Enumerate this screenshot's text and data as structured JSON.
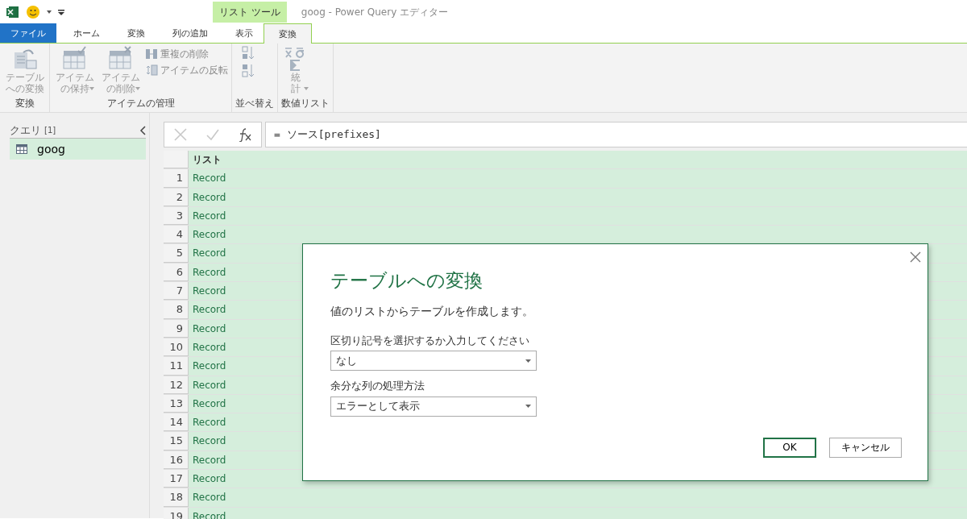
{
  "window": {
    "title": "goog - Power Query エディター",
    "context_label": "リスト ツール"
  },
  "tabs": [
    {
      "label": "ファイル",
      "kind": "file",
      "selected": false
    },
    {
      "label": "ホーム",
      "kind": "normal",
      "selected": false
    },
    {
      "label": "変換",
      "kind": "normal",
      "selected": false
    },
    {
      "label": "列の追加",
      "kind": "normal",
      "selected": false
    },
    {
      "label": "表示",
      "kind": "normal",
      "selected": false
    },
    {
      "label": "変換",
      "kind": "normal",
      "selected": true
    }
  ],
  "ribbon_groups": [
    {
      "label": "変換",
      "items": [
        {
          "kind": "large",
          "label": "テーブルへの変換",
          "caret": false,
          "disabled": true
        }
      ]
    },
    {
      "label": "アイテムの管理",
      "items": [
        {
          "kind": "large",
          "label": "アイテムの保持",
          "caret": true,
          "disabled": true
        },
        {
          "kind": "large",
          "label": "アイテムの削除",
          "caret": true,
          "disabled": true
        },
        {
          "kind": "small",
          "icons": [
            {
              "label": "重複の削除",
              "disabled": true
            },
            {
              "label": "アイテムの反転",
              "disabled": true
            }
          ]
        }
      ]
    },
    {
      "label": "並べ替え",
      "items": [
        {
          "kind": "sort",
          "disabled": true
        }
      ]
    },
    {
      "label": "数値リスト",
      "items": [
        {
          "kind": "large",
          "label": "統計",
          "caret": true,
          "disabled": true
        }
      ]
    }
  ],
  "queries": {
    "title": "クエリ",
    "count": "[1]",
    "items": [
      {
        "label": "goog",
        "selected": true
      }
    ]
  },
  "formula_bar": {
    "formula": "= ソース[prefixes]"
  },
  "table": {
    "column": "リスト",
    "rows": [
      {
        "n": "1",
        "v": "Record"
      },
      {
        "n": "2",
        "v": "Record"
      },
      {
        "n": "3",
        "v": "Record"
      },
      {
        "n": "4",
        "v": "Record"
      },
      {
        "n": "5",
        "v": "Record"
      },
      {
        "n": "6",
        "v": "Record"
      },
      {
        "n": "7",
        "v": "Record"
      },
      {
        "n": "8",
        "v": "Record"
      },
      {
        "n": "9",
        "v": "Record"
      },
      {
        "n": "10",
        "v": "Record"
      },
      {
        "n": "11",
        "v": "Record"
      },
      {
        "n": "12",
        "v": "Record"
      },
      {
        "n": "13",
        "v": "Record"
      },
      {
        "n": "14",
        "v": "Record"
      },
      {
        "n": "15",
        "v": "Record"
      },
      {
        "n": "16",
        "v": "Record"
      },
      {
        "n": "17",
        "v": "Record"
      },
      {
        "n": "18",
        "v": "Record"
      },
      {
        "n": "19",
        "v": "Record"
      }
    ]
  },
  "dialog": {
    "title": "テーブルへの変換",
    "description": "値のリストからテーブルを作成します。",
    "fields": [
      {
        "label": "区切り記号を選択するか入力してください",
        "value": "なし"
      },
      {
        "label": "余分な列の処理方法",
        "value": "エラーとして表示"
      }
    ],
    "buttons": [
      {
        "label": "OK",
        "kind": "primary"
      },
      {
        "label": "キャンセル",
        "kind": "secondary"
      }
    ]
  }
}
